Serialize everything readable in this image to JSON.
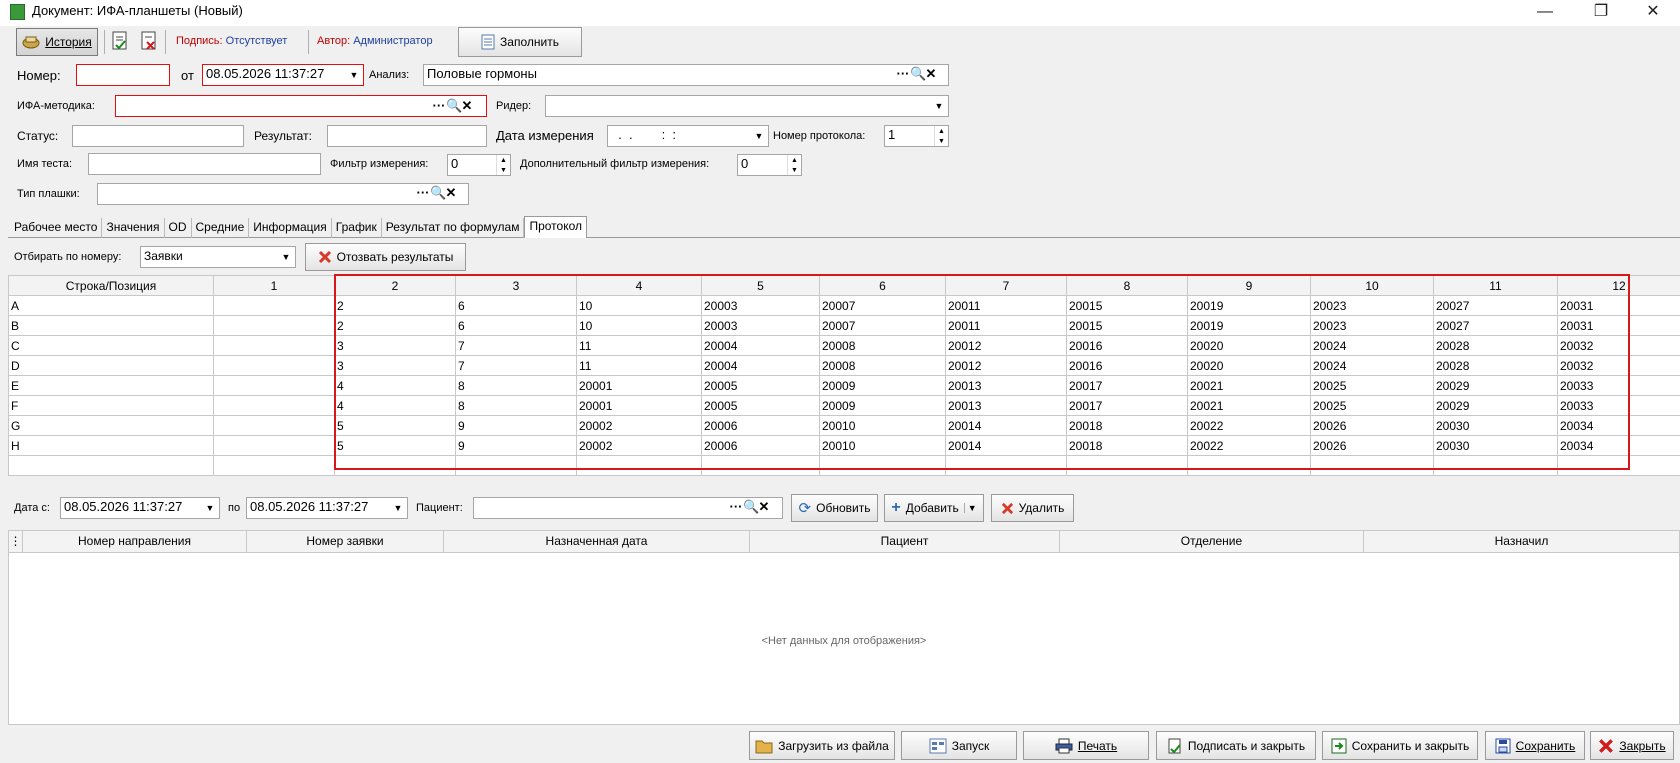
{
  "window": {
    "title": "Документ: ИФА-планшеты (Новый)",
    "minimize": "—",
    "restore": "❐",
    "close": "✕"
  },
  "toolbar": {
    "history_label": "История",
    "signature_label": "Подпись:",
    "signature_value": "Отсутствует",
    "author_label": "Автор:",
    "author_value": "Администратор",
    "fill_label": "Заполнить",
    "signature_label_color": "#c00000",
    "signature_value_color": "#1f3fa0"
  },
  "header": {
    "number_label": "Номер:",
    "number_value": "",
    "from_label": "от",
    "date_value": "08.05.2026 11:37:27",
    "analysis_label": "Анализ:",
    "analysis_value": "Половые гормоны",
    "method_label": "ИФА-методика:",
    "method_value": "",
    "reader_label": "Ридер:",
    "reader_value": "",
    "status_label": "Статус:",
    "status_value": "",
    "result_label": "Результат:",
    "result_value": "",
    "measure_date_label": "Дата измерения",
    "measure_date_value": "  .  .        :  :",
    "protocol_no_label": "Номер протокола:",
    "protocol_no_value": "1",
    "test_name_label": "Имя теста:",
    "test_name_value": "",
    "measure_filter_label": "Фильтр измерения:",
    "measure_filter_value": "0",
    "extra_filter_label": "Дополнительный фильтр измерения:",
    "extra_filter_value": "0",
    "plate_type_label": "Тип плашки:",
    "plate_type_value": ""
  },
  "tabs": [
    "Рабочее место",
    "Значения",
    "OD",
    "Средние",
    "Информация",
    "График",
    "Результат по формулам",
    "Протокол"
  ],
  "active_tab": "Протокол",
  "protocol": {
    "select_by_label": "Отбирать по номеру:",
    "select_by_value": "Заявки",
    "recall_label": "Отозвать результаты"
  },
  "plate_grid": {
    "headers": [
      "Строка/Позиция",
      "1",
      "2",
      "3",
      "4",
      "5",
      "6",
      "7",
      "8",
      "9",
      "10",
      "11",
      "12"
    ],
    "rows": [
      [
        "A",
        "",
        "2",
        "6",
        "10",
        "20003",
        "20007",
        "20011",
        "20015",
        "20019",
        "20023",
        "20027",
        "20031"
      ],
      [
        "B",
        "",
        "2",
        "6",
        "10",
        "20003",
        "20007",
        "20011",
        "20015",
        "20019",
        "20023",
        "20027",
        "20031"
      ],
      [
        "C",
        "",
        "3",
        "7",
        "11",
        "20004",
        "20008",
        "20012",
        "20016",
        "20020",
        "20024",
        "20028",
        "20032"
      ],
      [
        "D",
        "",
        "3",
        "7",
        "11",
        "20004",
        "20008",
        "20012",
        "20016",
        "20020",
        "20024",
        "20028",
        "20032"
      ],
      [
        "E",
        "",
        "4",
        "8",
        "20001",
        "20005",
        "20009",
        "20013",
        "20017",
        "20021",
        "20025",
        "20029",
        "20033"
      ],
      [
        "F",
        "",
        "4",
        "8",
        "20001",
        "20005",
        "20009",
        "20013",
        "20017",
        "20021",
        "20025",
        "20029",
        "20033"
      ],
      [
        "G",
        "",
        "5",
        "9",
        "20002",
        "20006",
        "20010",
        "20014",
        "20018",
        "20022",
        "20026",
        "20030",
        "20034"
      ],
      [
        "H",
        "",
        "5",
        "9",
        "20002",
        "20006",
        "20010",
        "20014",
        "20018",
        "20022",
        "20026",
        "20030",
        "20034"
      ]
    ]
  },
  "filter": {
    "date_from_label": "Дата с:",
    "date_from_value": "08.05.2026 11:37:27",
    "to_label": "по",
    "date_to_value": "08.05.2026 11:37:27",
    "patient_label": "Пациент:",
    "patient_value": "",
    "refresh_label": "Обновить",
    "add_label": "Добавить",
    "delete_label": "Удалить"
  },
  "orders_grid": {
    "headers": [
      "Номер направления",
      "Номер заявки",
      "Назначенная дата",
      "Пациент",
      "Отделение",
      "Назначил"
    ],
    "empty_text": "<Нет данных для отображения>"
  },
  "footer": {
    "load_label": "Загрузить из файла",
    "run_label": "Запуск",
    "print_label": "Печать",
    "sign_close_label": "Подписать и закрыть",
    "save_close_label": "Сохранить и закрыть",
    "save_label": "Сохранить",
    "close_label": "Закрыть"
  }
}
